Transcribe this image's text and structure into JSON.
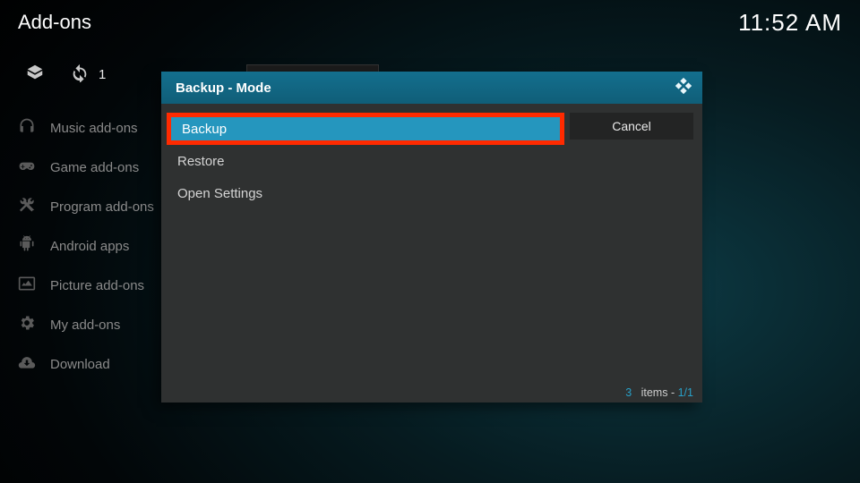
{
  "header": {
    "title": "Add-ons",
    "clock": "11:52 AM",
    "badge_count": "1"
  },
  "sidebar": {
    "items": [
      {
        "label": "Music add-ons"
      },
      {
        "label": "Game add-ons"
      },
      {
        "label": "Program add-ons"
      },
      {
        "label": "Android apps"
      },
      {
        "label": "Picture add-ons"
      },
      {
        "label": "My add-ons"
      },
      {
        "label": "Download"
      }
    ]
  },
  "dialog": {
    "title": "Backup - Mode",
    "options": [
      {
        "label": "Backup",
        "selected": true
      },
      {
        "label": "Restore",
        "selected": false
      },
      {
        "label": "Open Settings",
        "selected": false
      }
    ],
    "cancel_label": "Cancel",
    "footer_count": "3",
    "footer_items_word": "items",
    "footer_sep": " - ",
    "footer_page": "1/1"
  }
}
